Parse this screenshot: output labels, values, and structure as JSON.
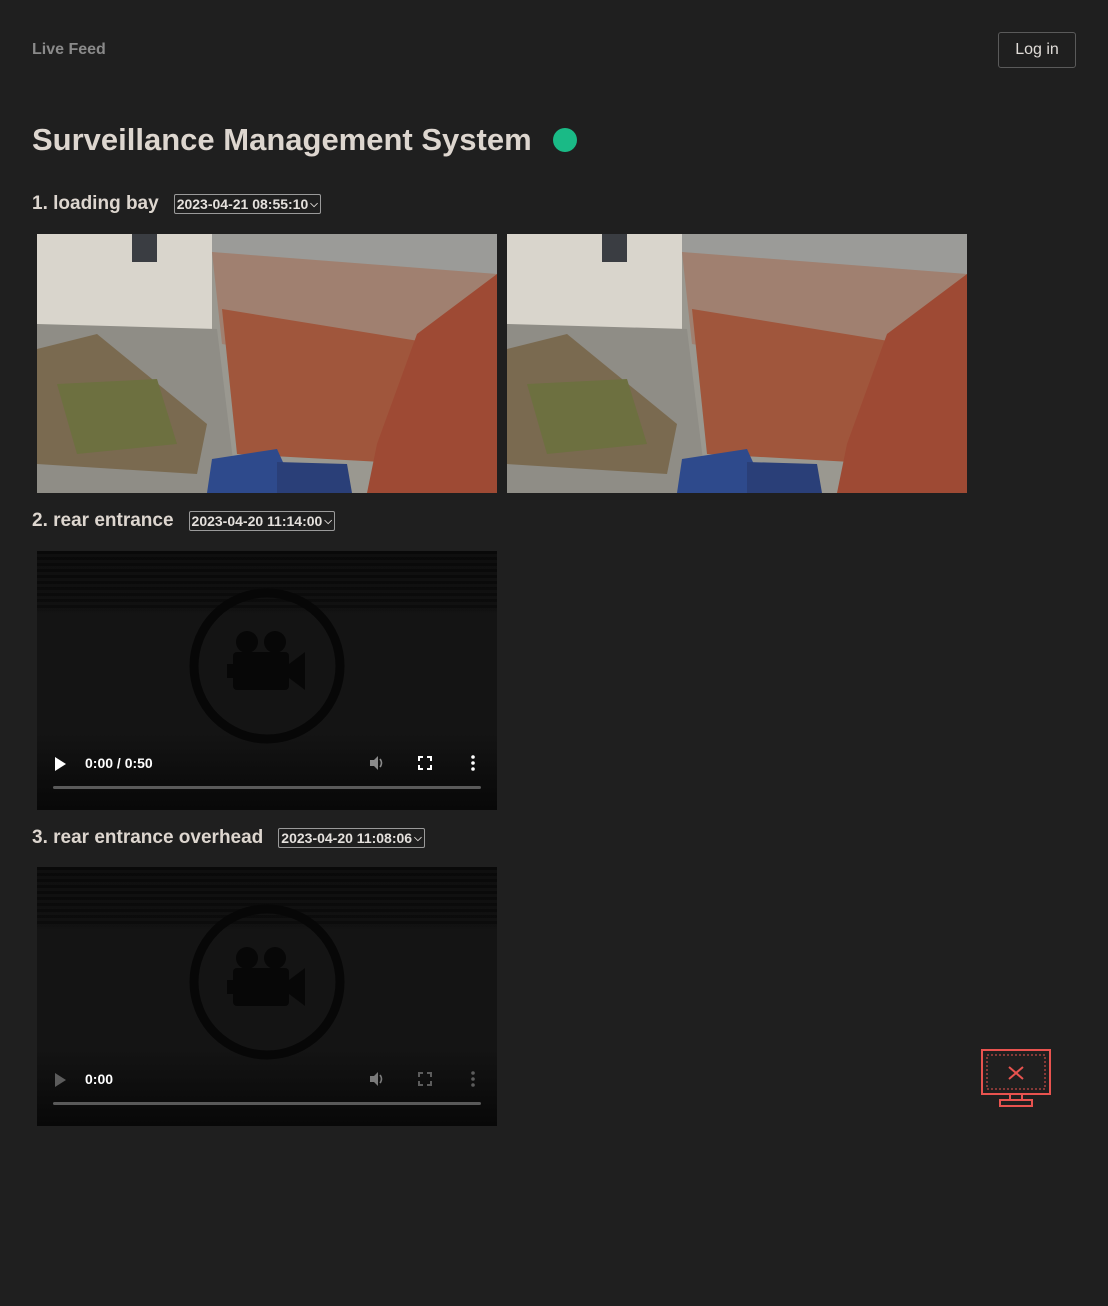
{
  "nav": {
    "brand": "Live Feed",
    "login_label": "Log in"
  },
  "page": {
    "title": "Surveillance Management System",
    "status_color": "#1aba86"
  },
  "cameras": [
    {
      "label": "1. loading bay",
      "selected_time": "2023-04-21 08:55:10"
    },
    {
      "label": "2. rear entrance",
      "selected_time": "2023-04-20 11:14:00",
      "player": {
        "time": "0:00 / 0:50"
      }
    },
    {
      "label": "3. rear entrance overhead",
      "selected_time": "2023-04-20 11:08:06",
      "player": {
        "time": "0:00"
      }
    }
  ],
  "icons": {
    "status": "status-dot",
    "video_placeholder": "video-camera-icon",
    "play": "play-icon",
    "volume": "volume-icon",
    "fullscreen": "fullscreen-icon",
    "menu": "more-vert-icon",
    "disconnected": "screen-disconnected-icon"
  },
  "colors": {
    "background": "#1f1f1f",
    "accent_red": "#e8534f"
  }
}
